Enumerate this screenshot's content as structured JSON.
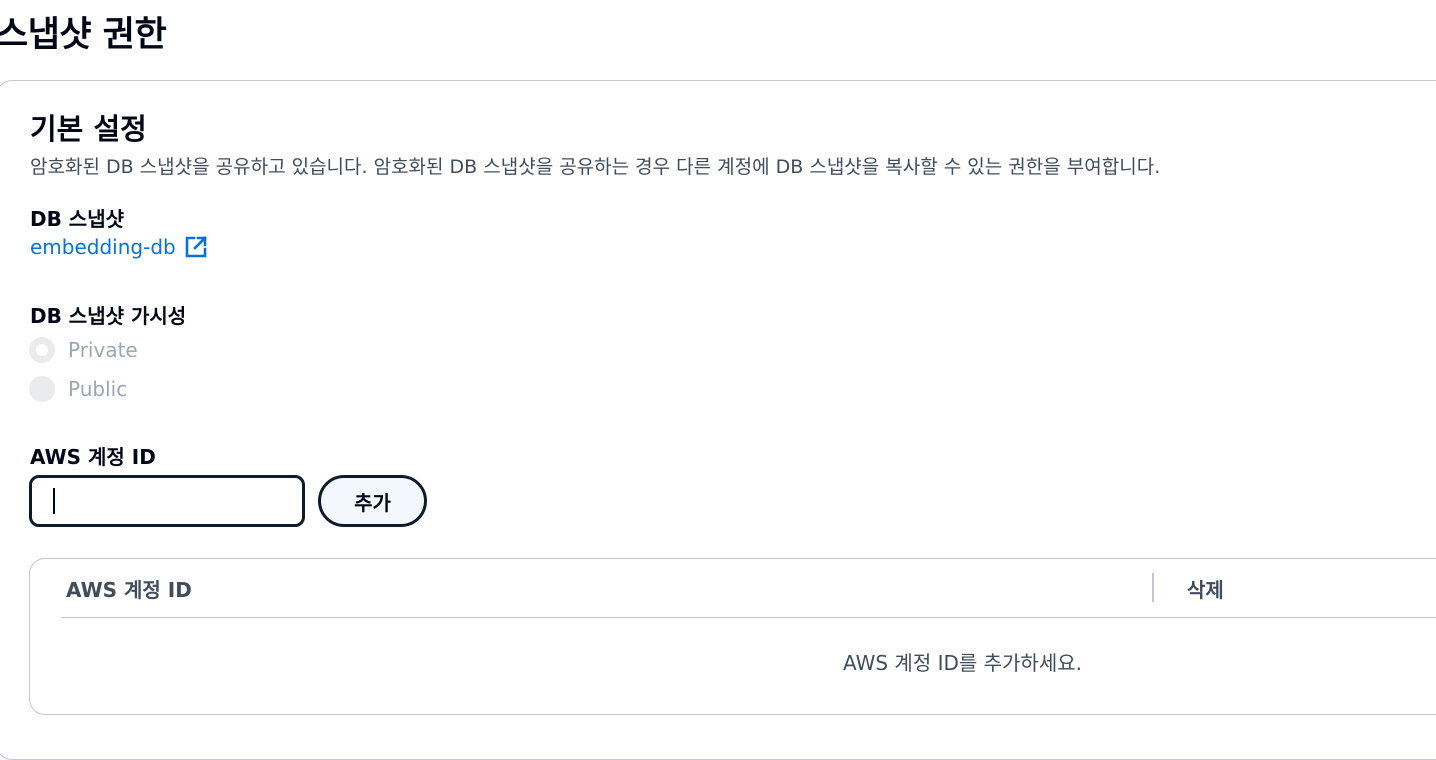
{
  "page": {
    "title": "스냅샷 권한"
  },
  "section": {
    "title": "기본 설정",
    "description": "암호화된 DB 스냅샷을 공유하고 있습니다. 암호화된 DB 스냅샷을 공유하는 경우 다른 계정에 DB 스냅샷을 복사할 수 있는 권한을 부여합니다."
  },
  "snapshot": {
    "label": "DB 스냅샷",
    "link_text": "embedding-db",
    "link_icon": "external-link-icon"
  },
  "visibility": {
    "label": "DB 스냅샷 가시성",
    "options": [
      {
        "label": "Private",
        "checked": true,
        "disabled": true
      },
      {
        "label": "Public",
        "checked": false,
        "disabled": true
      }
    ]
  },
  "account": {
    "label": "AWS 계정 ID",
    "input_value": "",
    "add_button": "추가"
  },
  "table": {
    "columns": [
      "AWS 계정 ID",
      "삭제"
    ],
    "empty_message": "AWS 계정 ID를 추가하세요."
  },
  "colors": {
    "link": "#0972d3",
    "text": "#000716",
    "muted": "#414d5c",
    "disabled": "#9ba7b6"
  }
}
